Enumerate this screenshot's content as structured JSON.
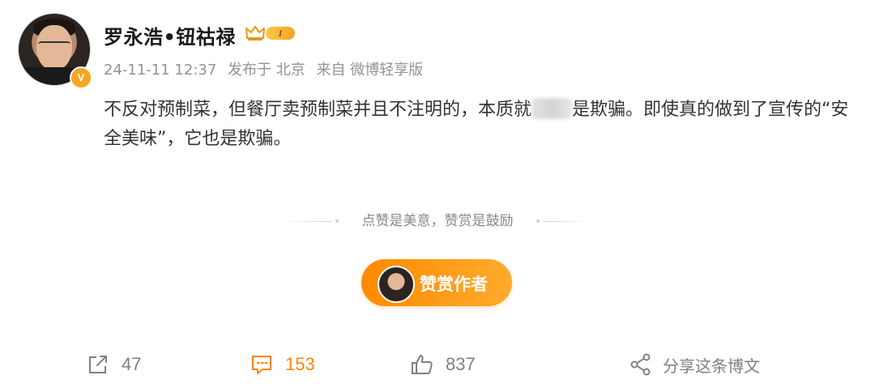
{
  "author": {
    "name": "罗永浩•钮祜禄",
    "verify_mark": "V",
    "vip_level": "I"
  },
  "meta": {
    "timestamp": "24-11-11 12:37",
    "location": "发布于 北京",
    "source": "来自 微博轻享版"
  },
  "post": {
    "text_part1": "不反对预制菜，但餐厅卖预制菜并且不注明的，本质就",
    "text_part2": "是欺骗。即使真的做到了宣传的“安全美味”，它也是欺骗。"
  },
  "reward": {
    "prompt": "点赞是美意，赞赏是鼓励",
    "button_label": "赞赏作者"
  },
  "actions": {
    "repost_count": "47",
    "comment_count": "153",
    "like_count": "837",
    "share_label": "分享这条博文"
  },
  "colors": {
    "accent": "#ff8200",
    "muted": "#939393",
    "text": "#333333"
  },
  "icons": {
    "verify": "verified-v-icon",
    "vip": "crown-icon",
    "repost": "repost-icon",
    "comment": "comment-icon",
    "like": "thumbs-up-icon",
    "share": "share-icon"
  }
}
